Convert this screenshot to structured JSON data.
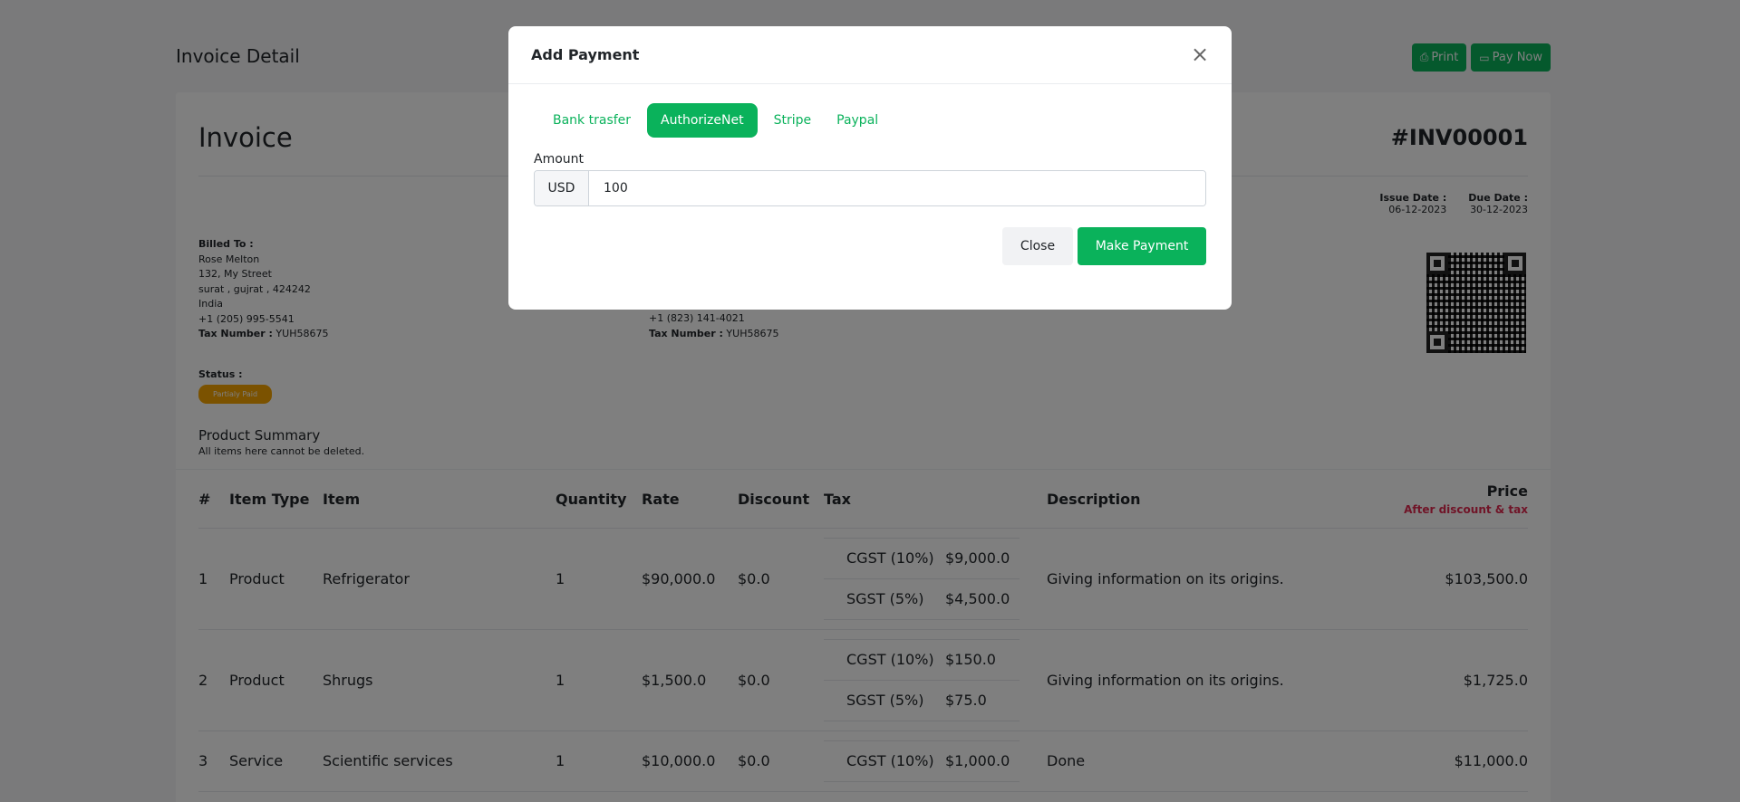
{
  "page": {
    "title": "Invoice Detail",
    "print_label": "Print",
    "pay_now_label": "Pay Now"
  },
  "invoice": {
    "heading": "Invoice",
    "number": "#INV00001",
    "issue_date_label": "Issue Date :",
    "issue_date": "06-12-2023",
    "due_date_label": "Due Date :",
    "due_date": "30-12-2023",
    "billed_to_label": "Billed To :",
    "billed_to": {
      "name": "Rose Melton",
      "street": "132, My Street",
      "city": "surat , gujrat , 424242",
      "country": "India",
      "phone": "+1 (205) 995-5541",
      "tax_label": "Tax Number :",
      "tax_number": "YUH58675"
    },
    "shipped_to": {
      "phone": "+1 (823) 141-4021",
      "tax_label": "Tax Number :",
      "tax_number": "YUH58675"
    },
    "status_label": "Status :",
    "status": "Partialy Paid",
    "summary_title": "Product Summary",
    "summary_note": "All items here cannot be deleted."
  },
  "table": {
    "headers": [
      "#",
      "Item Type",
      "Item",
      "Quantity",
      "Rate",
      "Discount",
      "Tax",
      "Description",
      "Price"
    ],
    "price_sub": "After discount & tax",
    "rows": [
      {
        "num": "1",
        "type": "Product",
        "item": "Refrigerator",
        "qty": "1",
        "rate": "$90,000.0",
        "discount": "$0.0",
        "tax": [
          {
            "name": "CGST (10%)",
            "amount": "$9,000.0"
          },
          {
            "name": "SGST (5%)",
            "amount": "$4,500.0"
          }
        ],
        "description": "Giving information on its origins.",
        "price": "$103,500.0"
      },
      {
        "num": "2",
        "type": "Product",
        "item": "Shrugs",
        "qty": "1",
        "rate": "$1,500.0",
        "discount": "$0.0",
        "tax": [
          {
            "name": "CGST (10%)",
            "amount": "$150.0"
          },
          {
            "name": "SGST (5%)",
            "amount": "$75.0"
          }
        ],
        "description": "Giving information on its origins.",
        "price": "$1,725.0"
      },
      {
        "num": "3",
        "type": "Service",
        "item": "Scientific services",
        "qty": "1",
        "rate": "$10,000.0",
        "discount": "$0.0",
        "tax": [
          {
            "name": "CGST (10%)",
            "amount": "$1,000.0"
          }
        ],
        "description": "Done",
        "price": "$11,000.0"
      }
    ]
  },
  "modal": {
    "title": "Add Payment",
    "tabs": [
      "Bank trasfer",
      "AuthorizeNet",
      "Stripe",
      "Paypal"
    ],
    "active_tab": "AuthorizeNet",
    "amount_label": "Amount",
    "currency": "USD",
    "amount_value": "100",
    "close_label": "Close",
    "pay_label": "Make Payment"
  },
  "colors": {
    "accent": "#0ab25b",
    "status_badge": "#f7a400",
    "price_note": "#e0284f"
  }
}
